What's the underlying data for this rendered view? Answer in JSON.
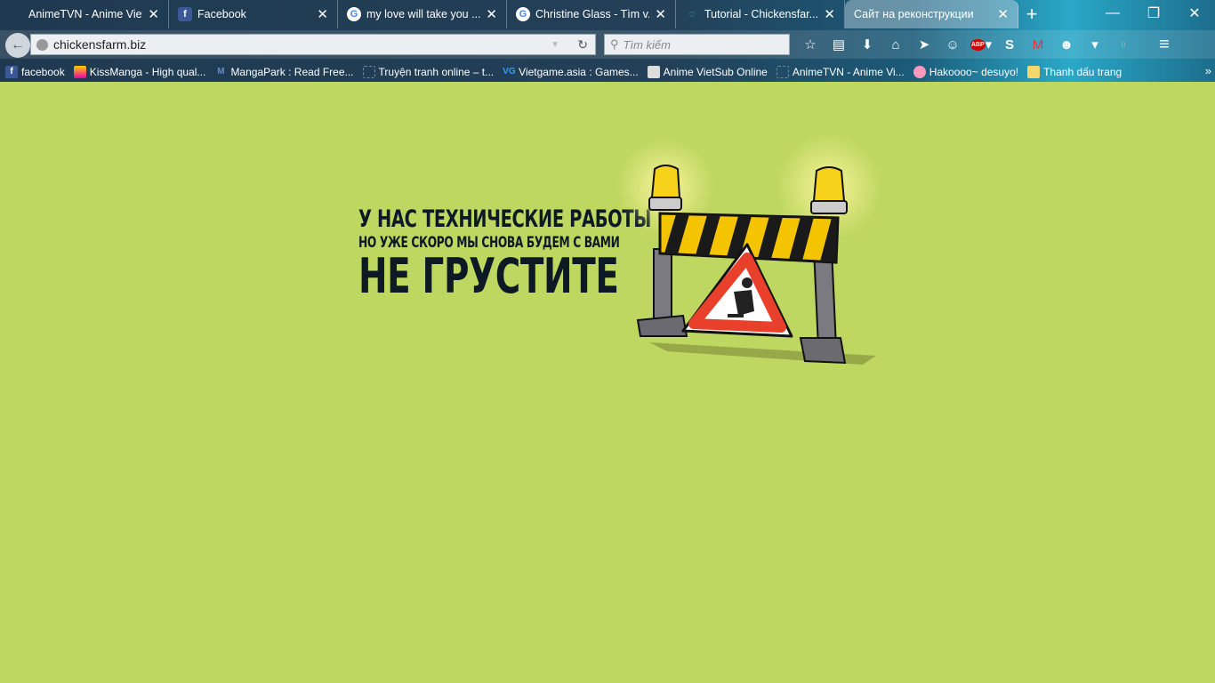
{
  "tabs": [
    {
      "title": "AnimeTVN - Anime Vietsu...",
      "icon": "animetvn-icon"
    },
    {
      "title": "Facebook",
      "icon": "facebook-icon"
    },
    {
      "title": "my love will take you ...",
      "icon": "google-icon"
    },
    {
      "title": "Christine Glass - Tìm v...",
      "icon": "google-icon"
    },
    {
      "title": "Tutorial - Chickensfar...",
      "icon": "loading-icon"
    },
    {
      "title": "Сайт на реконструкции",
      "icon": "",
      "active": true
    }
  ],
  "address": {
    "url": "chickensfarm.biz"
  },
  "search": {
    "placeholder": "Tìm kiếm"
  },
  "toolbar": {
    "badge_count": "0",
    "abp_label": "ABP"
  },
  "bookmarks": [
    {
      "label": "facebook",
      "icon": "facebook-icon"
    },
    {
      "label": "KissManga - High qual...",
      "icon": "kissmanga-icon"
    },
    {
      "label": "MangaPark : Read Free...",
      "icon": "mangapark-icon"
    },
    {
      "label": "Truyện tranh online – t...",
      "icon": "page-icon"
    },
    {
      "label": "Vietgame.asia : Games...",
      "icon": "vg-icon"
    },
    {
      "label": "Anime VietSub Online",
      "icon": "anime-icon"
    },
    {
      "label": "AnimeTVN - Anime Vi...",
      "icon": "page-icon"
    },
    {
      "label": "Hakoooo~ desuyo!",
      "icon": "hako-icon"
    },
    {
      "label": "Thanh dấu trang",
      "icon": "folder-icon"
    }
  ],
  "page": {
    "line1": "У НАС ТЕХНИЧЕСКИЕ РАБОТЫ",
    "line2": "НО УЖЕ СКОРО МЫ СНОВА БУДЕМ С ВАМИ",
    "line3": "НЕ ГРУСТИТЕ",
    "background": "#bed760"
  }
}
